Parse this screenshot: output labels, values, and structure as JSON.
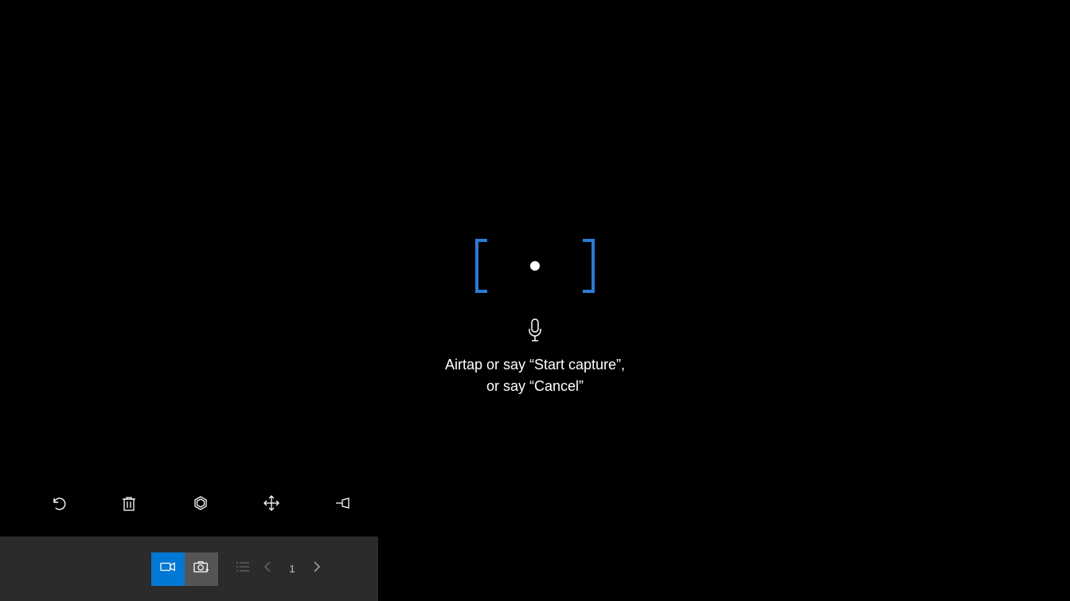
{
  "instruction": {
    "line1": "Airtap or say “Start capture”,",
    "line2": "or say “Cancel”"
  },
  "upper_toolbar": {
    "undo": "undo",
    "delete": "delete",
    "three_d": "3d-view",
    "move": "move",
    "pin": "pin"
  },
  "bottom_bar": {
    "video_mode": "video",
    "photo_mode": "photo",
    "list": "list",
    "prev": "previous",
    "page": "1",
    "next": "next"
  },
  "colors": {
    "accent": "#0078d4",
    "bracket": "#2b7cd3"
  }
}
